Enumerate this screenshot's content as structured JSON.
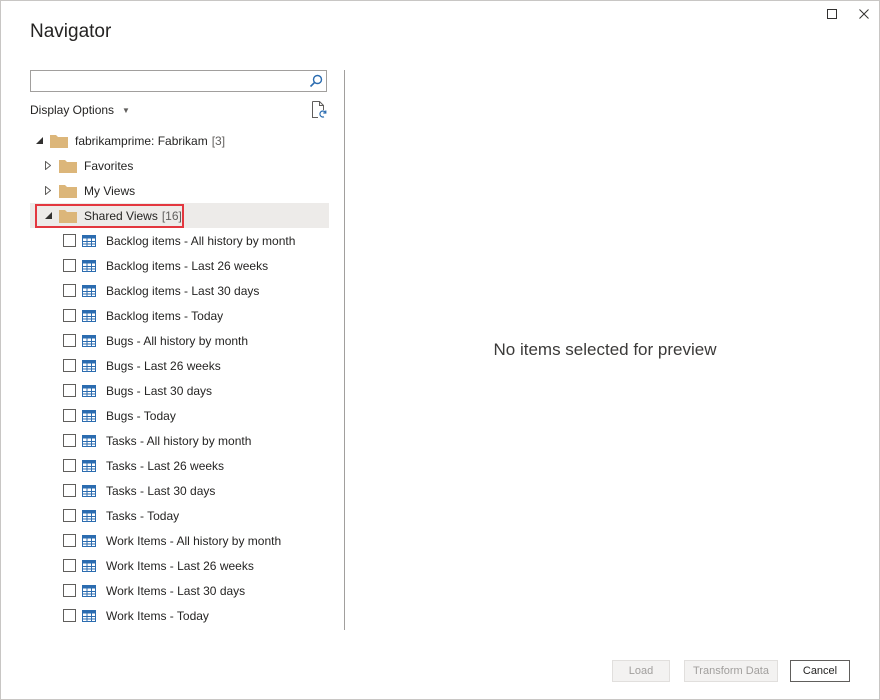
{
  "window": {
    "title": "Navigator",
    "maximize_icon": "maximize-icon",
    "close_icon": "close-icon"
  },
  "search": {
    "value": "",
    "placeholder": "",
    "icon": "search-icon"
  },
  "display_options": {
    "label": "Display Options",
    "icon": "chevron-down-icon"
  },
  "refresh_icon": "refresh-document-icon",
  "tree": {
    "root": {
      "label": "fabrikamprime: Fabrikam",
      "count": "[3]",
      "expanded": true
    },
    "folders": [
      {
        "label": "Favorites",
        "count": "",
        "expanded": false
      },
      {
        "label": "My Views",
        "count": "",
        "expanded": false
      },
      {
        "label": "Shared Views",
        "count": "[16]",
        "expanded": true,
        "highlighted": true
      }
    ],
    "items": [
      {
        "label": "Backlog items - All history by month",
        "checked": false
      },
      {
        "label": "Backlog items - Last 26 weeks",
        "checked": false
      },
      {
        "label": "Backlog items - Last 30 days",
        "checked": false
      },
      {
        "label": "Backlog items - Today",
        "checked": false
      },
      {
        "label": "Bugs - All history by month",
        "checked": false
      },
      {
        "label": "Bugs - Last 26 weeks",
        "checked": false
      },
      {
        "label": "Bugs - Last 30 days",
        "checked": false
      },
      {
        "label": "Bugs - Today",
        "checked": false
      },
      {
        "label": "Tasks - All history by month",
        "checked": false
      },
      {
        "label": "Tasks - Last 26 weeks",
        "checked": false
      },
      {
        "label": "Tasks - Last 30 days",
        "checked": false
      },
      {
        "label": "Tasks - Today",
        "checked": false
      },
      {
        "label": "Work Items - All history by month",
        "checked": false
      },
      {
        "label": "Work Items - Last 26 weeks",
        "checked": false
      },
      {
        "label": "Work Items - Last 30 days",
        "checked": false
      },
      {
        "label": "Work Items - Today",
        "checked": false
      }
    ]
  },
  "preview": {
    "message": "No items selected for preview"
  },
  "buttons": {
    "load": "Load",
    "transform": "Transform Data",
    "cancel": "Cancel"
  },
  "colors": {
    "highlight": "#e3373f",
    "folder": "#dcb67a",
    "table_icon": "#2b6cb0"
  }
}
